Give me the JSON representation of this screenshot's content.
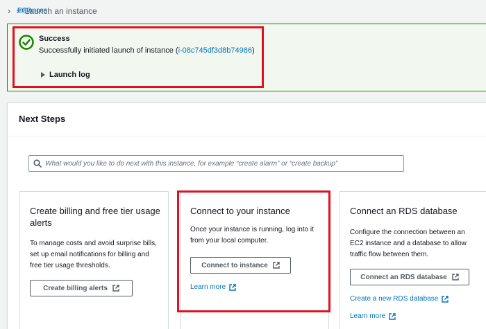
{
  "breadcrumb": {
    "item1": "EC2",
    "item2": "Instances",
    "current": "Launch an instance"
  },
  "flash": {
    "title": "Success",
    "message_prefix": "Successfully initiated launch of instance (",
    "instance_id": "i-08c745df3d8b74986",
    "message_suffix": ")",
    "launch_log": "Launch log"
  },
  "next_steps": {
    "title": "Next Steps",
    "search_placeholder": "What would you like to do next with this instance, for example “create alarm” or “create backup”",
    "cards": [
      {
        "title": "Create billing and free tier usage alerts",
        "description": "To manage costs and avoid surprise bills, set up email notifications for billing and free tier usage thresholds.",
        "button": "Create billing alerts"
      },
      {
        "title": "Connect to your instance",
        "description": "Once your instance is running, log into it from your local computer.",
        "button": "Connect to instance",
        "link": "Learn more"
      },
      {
        "title": "Connect an RDS database",
        "description": "Configure the connection between an EC2 instance and a database to allow traffic flow between them.",
        "button": "Connect an RDS database",
        "link1": "Create a new RDS database",
        "link2": "Learn more"
      }
    ]
  },
  "colors": {
    "link": "#0073bb",
    "success": "#1d8102",
    "highlight": "#e01020"
  }
}
